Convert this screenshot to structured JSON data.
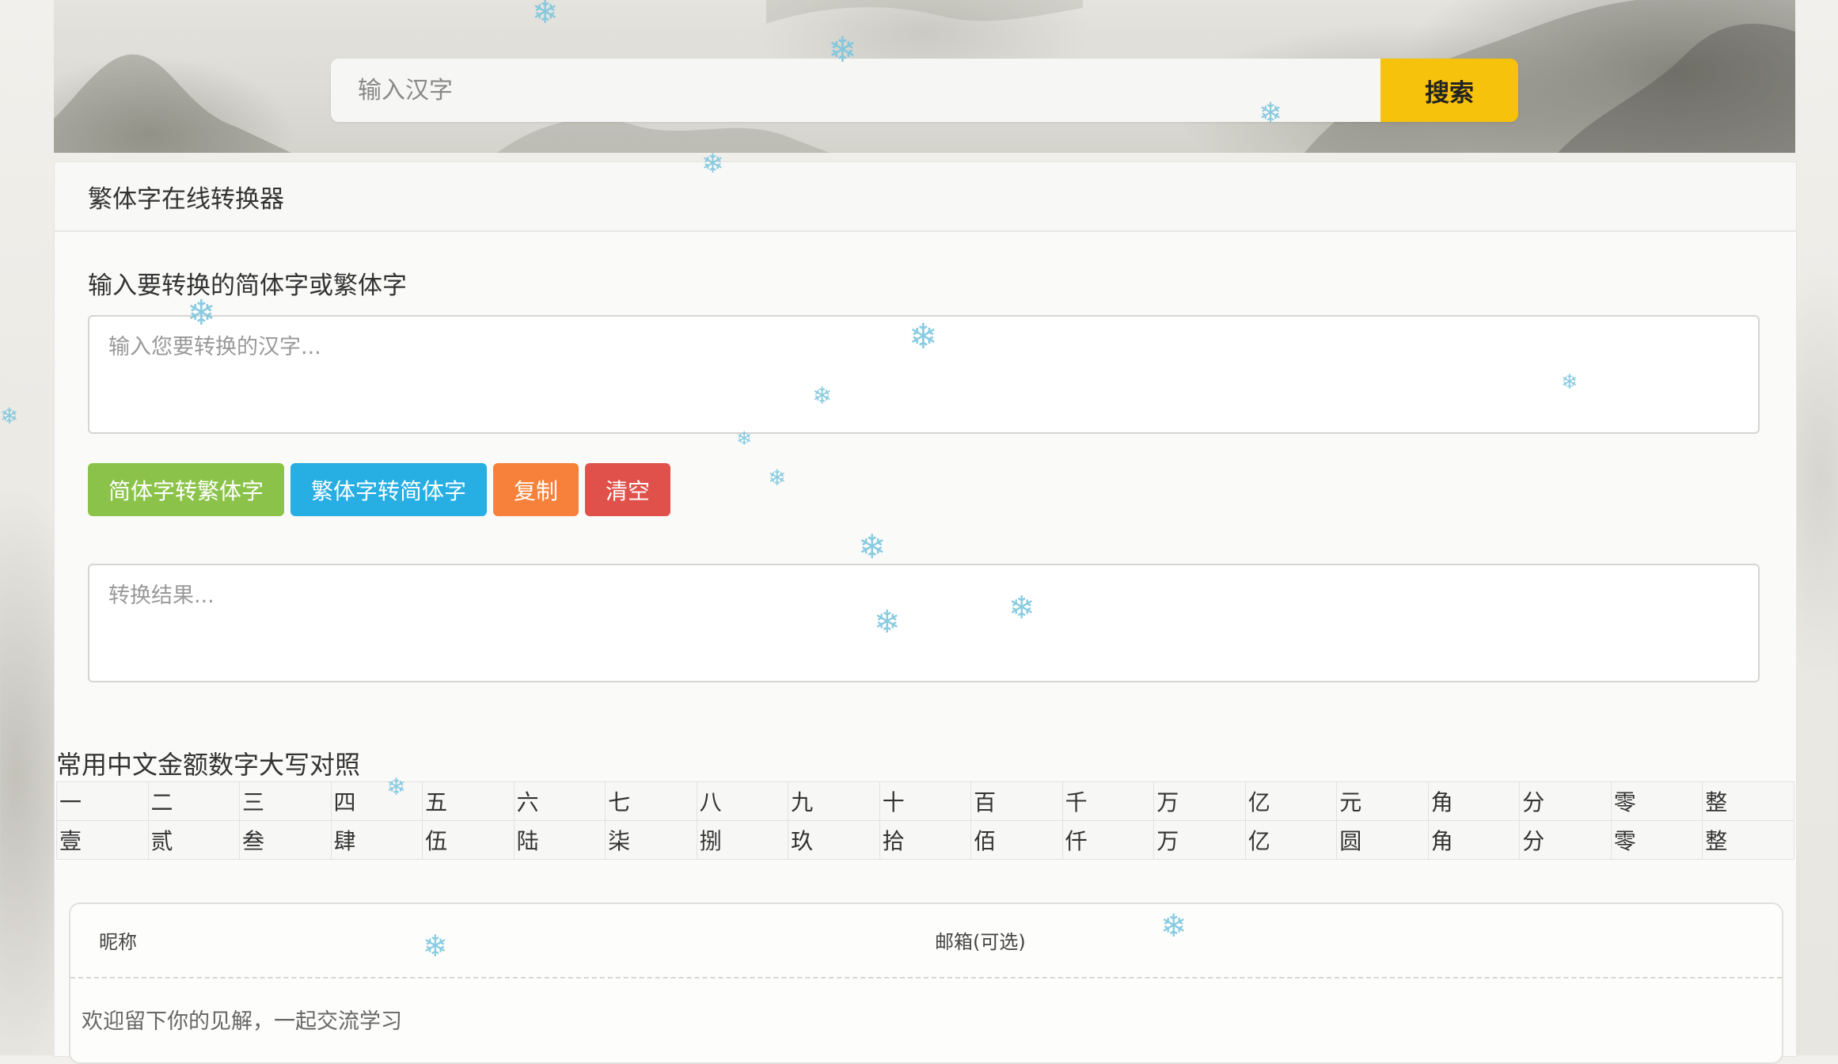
{
  "search": {
    "placeholder": "输入汉字",
    "button_label": "搜索"
  },
  "panel": {
    "title": "繁体字在线转换器",
    "input_label": "输入要转换的简体字或繁体字",
    "input_placeholder": "输入您要转换的汉字...",
    "output_placeholder": "转换结果...",
    "buttons": {
      "to_traditional": "简体字转繁体字",
      "to_simplified": "繁体字转简体字",
      "copy": "复制",
      "clear": "清空"
    }
  },
  "amount_table": {
    "title": "常用中文金额数字大写对照",
    "row_lower": [
      "一",
      "二",
      "三",
      "四",
      "五",
      "六",
      "七",
      "八",
      "九",
      "十",
      "百",
      "千",
      "万",
      "亿",
      "元",
      "角",
      "分",
      "零",
      "整"
    ],
    "row_upper": [
      "壹",
      "贰",
      "叁",
      "肆",
      "伍",
      "陆",
      "柒",
      "捌",
      "玖",
      "拾",
      "佰",
      "仟",
      "万",
      "亿",
      "圆",
      "角",
      "分",
      "零",
      "整"
    ]
  },
  "comment": {
    "nickname_label": "昵称",
    "email_label": "邮箱(可选)",
    "placeholder": "欢迎留下你的见解，一起交流学习"
  },
  "theme": {
    "search_button_color": "#f7c20b",
    "btn_green": "#8bc34a",
    "btn_blue": "#27aee3",
    "btn_orange": "#f7813a",
    "btn_red": "#e0514b",
    "snowflake_color": "#7cc6de"
  },
  "icons": {
    "snowflake": "snowflake-icon"
  }
}
